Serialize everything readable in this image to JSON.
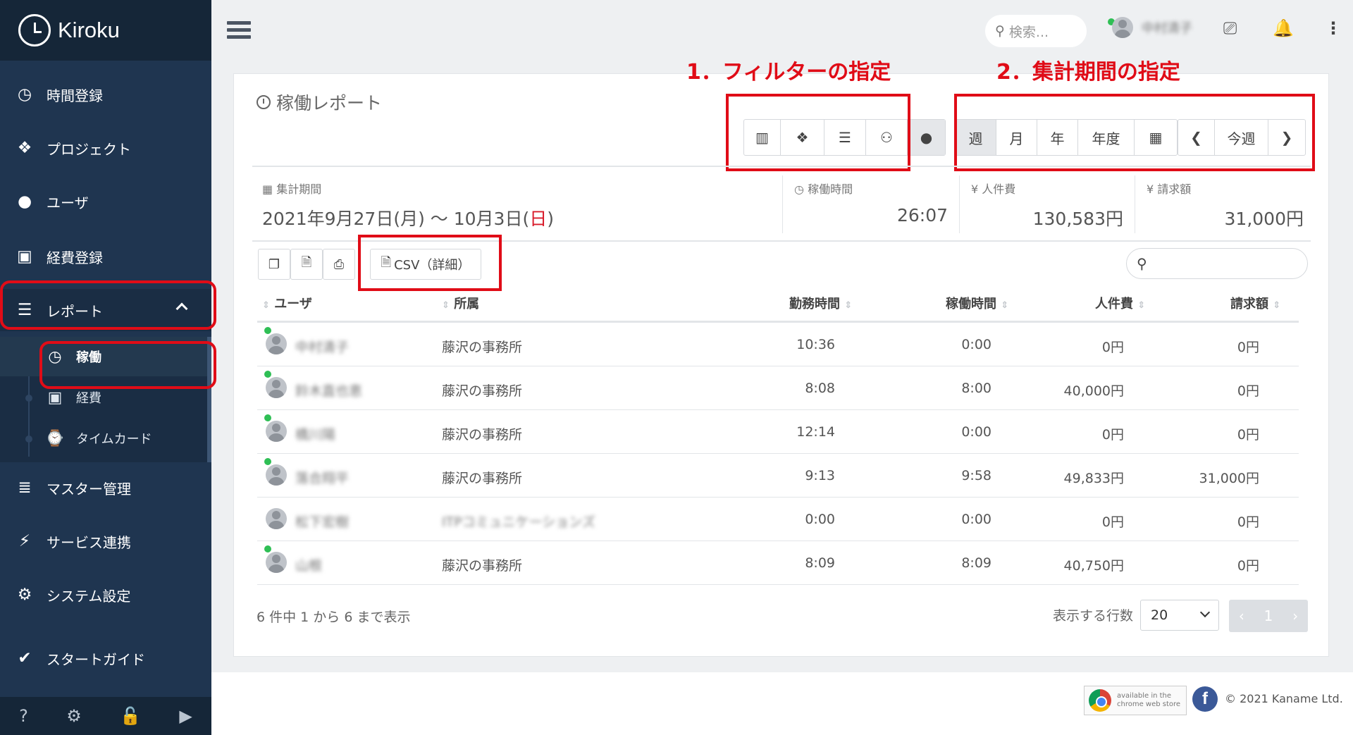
{
  "brand": {
    "name": "Kiroku"
  },
  "sidebar": {
    "items": [
      {
        "label": "時間登録",
        "icon": "clock-icon"
      },
      {
        "label": "プロジェクト",
        "icon": "cubes-icon"
      },
      {
        "label": "ユーザ",
        "icon": "user-icon"
      },
      {
        "label": "経費登録",
        "icon": "train-icon"
      },
      {
        "label": "レポート",
        "icon": "list-icon"
      },
      {
        "label": "マスター管理",
        "icon": "database-icon"
      },
      {
        "label": "サービス連携",
        "icon": "plug-icon"
      },
      {
        "label": "システム設定",
        "icon": "gear-icon"
      },
      {
        "label": "スタートガイド",
        "icon": "check-icon"
      }
    ],
    "report_subitems": [
      {
        "label": "稼働",
        "icon": "clock-icon"
      },
      {
        "label": "経費",
        "icon": "train-icon"
      },
      {
        "label": "タイムカード",
        "icon": "timecard-icon"
      }
    ]
  },
  "topbar": {
    "search_placeholder": "検索...",
    "user_name": "中村清子"
  },
  "report": {
    "title": "稼働レポート",
    "annotations": {
      "filter": "1．フィルターの指定",
      "period": "2．集計期間の指定"
    },
    "period_buttons": [
      "週",
      "月",
      "年",
      "年度"
    ],
    "today_button": "今週",
    "csv_button": "CSV（詳細）",
    "stats": {
      "period_label": "集計期間",
      "period_prefix": "2021年9月27日(月) ～ 10月3日(",
      "period_sunday": "日",
      "period_suffix": ")",
      "work_label": "稼働時間",
      "work_value": "26:07",
      "labor_label": "¥ 人件費",
      "labor_value": "130,583円",
      "billing_label": "¥ 請求額",
      "billing_value": "31,000円"
    },
    "columns": [
      "ユーザ",
      "所属",
      "勤務時間",
      "稼働時間",
      "人件費",
      "請求額"
    ],
    "rows": [
      {
        "user": "中村清子",
        "dept": "藤沢の事務所",
        "attendance": "10:36",
        "work": "0:00",
        "labor": "0円",
        "billing": "0円",
        "online": true
      },
      {
        "user": "鈴木直也恵",
        "dept": "藤沢の事務所",
        "attendance": "8:08",
        "work": "8:00",
        "labor": "40,000円",
        "billing": "0円",
        "online": true
      },
      {
        "user": "橋川陽",
        "dept": "藤沢の事務所",
        "attendance": "12:14",
        "work": "0:00",
        "labor": "0円",
        "billing": "0円",
        "online": true
      },
      {
        "user": "落合翔平",
        "dept": "藤沢の事務所",
        "attendance": "9:13",
        "work": "9:58",
        "labor": "49,833円",
        "billing": "31,000円",
        "online": true
      },
      {
        "user": "松下宏樹",
        "dept": "ITPコミュニケーションズ",
        "attendance": "0:00",
        "work": "0:00",
        "labor": "0円",
        "billing": "0円",
        "online": false
      },
      {
        "user": "山根",
        "dept": "藤沢の事務所",
        "attendance": "8:09",
        "work": "8:09",
        "labor": "40,750円",
        "billing": "0円",
        "online": true
      }
    ],
    "summary": "6 件中 1 から 6 まで表示",
    "rows_label": "表示する行数",
    "rows_value": "20",
    "page": "1"
  },
  "footer": {
    "chrome_store": "available in the chrome web store",
    "copyright": "© 2021 Kaname Ltd."
  },
  "colors": {
    "annotation": "#e00c17",
    "sidebar": "#1f3550",
    "online": "#2fbf55"
  }
}
